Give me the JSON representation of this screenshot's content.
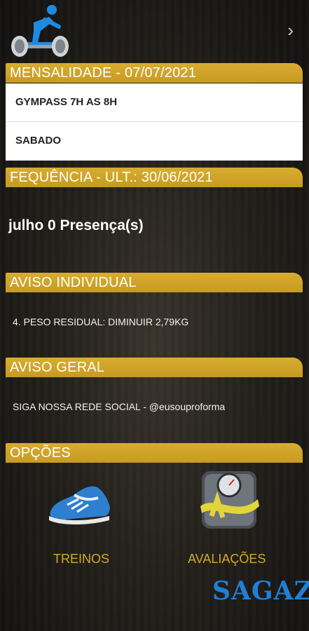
{
  "header": {
    "logo_icon": "weightlifter-logo-icon",
    "nav_icon": "chevron-right-icon"
  },
  "mensalidade": {
    "title": "MENSALIDADE - 07/07/2021",
    "rows": [
      "GYMPASS 7H AS 8H",
      "SABADO"
    ]
  },
  "frequencia": {
    "title": "FEQUÊNCIA - ULT.: 30/06/2021",
    "summary": "julho 0 Presença(s)"
  },
  "aviso_individual": {
    "title": "AVISO INDIVIDUAL",
    "text": "4. PESO RESIDUAL: DIMINUIR 2,79KG"
  },
  "aviso_geral": {
    "title": "AVISO GERAL",
    "text": "SIGA NOSSA REDE SOCIAL - @eusouproforma"
  },
  "opcoes": {
    "title": "OPÇÕES",
    "items": [
      {
        "label": "TREINOS",
        "icon": "sneaker-icon"
      },
      {
        "label": "AVALIAÇÕES",
        "icon": "scale-tape-icon"
      }
    ]
  },
  "brand": "SAGAZ",
  "colors": {
    "accent": "#d4a82c",
    "brand": "#1f7fd8"
  }
}
